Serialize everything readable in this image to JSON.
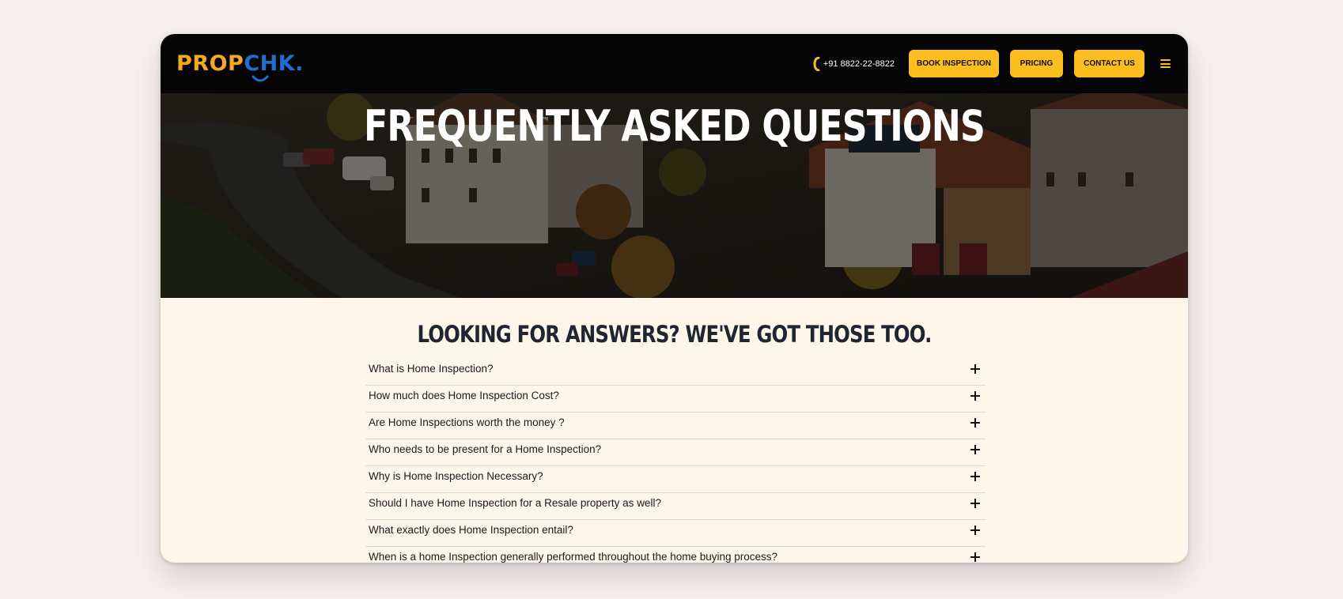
{
  "header": {
    "logo": {
      "part1": "PROP",
      "part2": "CHK",
      "dot": "."
    },
    "phone": "+91 8822-22-8822",
    "buttons": {
      "book": "BOOK INSPECTION",
      "pricing": "PRICING",
      "contact": "CONTACT US"
    },
    "icons": [
      "phone-icon",
      "hamburger-menu-icon"
    ]
  },
  "hero": {
    "title": "FREQUENTLY ASKED QUESTIONS"
  },
  "faq": {
    "heading": "LOOKING FOR ANSWERS? WE'VE GOT THOSE TOO.",
    "items": [
      {
        "question": "What is Home Inspection?"
      },
      {
        "question": "How much does Home Inspection Cost?"
      },
      {
        "question": "Are Home Inspections worth the money ?"
      },
      {
        "question": "Who needs to be present for a Home Inspection?"
      },
      {
        "question": "Why is Home Inspection Necessary?"
      },
      {
        "question": "Should I have Home Inspection for a Resale property as well?"
      },
      {
        "question": "What exactly does Home Inspection entail?"
      },
      {
        "question": "When is a home Inspection generally performed throughout the home buying process?"
      }
    ]
  },
  "colors": {
    "accent": "#fcbe1e",
    "logo_orange": "#f3a922",
    "logo_blue": "#1e6fcf",
    "navbar": "#050505",
    "section_bg": "#fdf6e9",
    "heading": "#1f2631"
  }
}
